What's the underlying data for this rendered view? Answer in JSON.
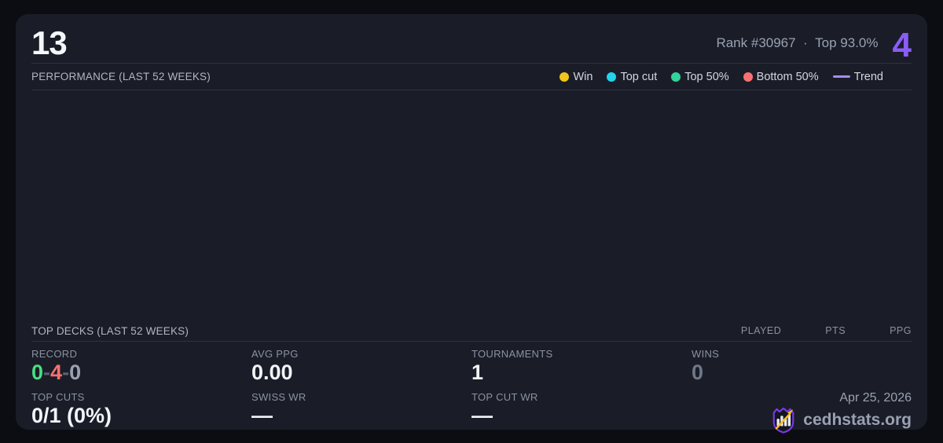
{
  "theme": {
    "page_bg": "#0c0d12",
    "card_bg": "#1a1d28",
    "divider": "#2e3342",
    "accent_purple": "#8b5cf6"
  },
  "header": {
    "title": "13",
    "rank": "Rank #30967",
    "separator": "·",
    "top_percent": "Top 93.0%",
    "color_count": "4",
    "color_count_color": "#8b5cf6"
  },
  "performance": {
    "section_title": "PERFORMANCE (LAST 52 WEEKS)",
    "legend": [
      {
        "label": "Win",
        "color": "#f2c51d",
        "shape": "dot"
      },
      {
        "label": "Top cut",
        "color": "#22d3ee",
        "shape": "dot"
      },
      {
        "label": "Top 50%",
        "color": "#34d399",
        "shape": "dot"
      },
      {
        "label": "Bottom 50%",
        "color": "#f87171",
        "shape": "dot"
      },
      {
        "label": "Trend",
        "color": "#a78bfa",
        "shape": "line"
      }
    ],
    "chart_data": {
      "type": "scatter",
      "points": [],
      "note": "chart area is empty — no events plotted"
    }
  },
  "top_decks": {
    "section_title": "TOP DECKS (LAST 52 WEEKS)",
    "columns": [
      "PLAYED",
      "PTS",
      "PPG"
    ],
    "rows": []
  },
  "stats": {
    "record": {
      "label": "RECORD",
      "parts": [
        {
          "text": "0",
          "color": "#4ade80"
        },
        {
          "text": "-",
          "color": "#5a6170"
        },
        {
          "text": "4",
          "color": "#f87171"
        },
        {
          "text": "-",
          "color": "#5a6170"
        },
        {
          "text": "0",
          "color": "#9aa1b1"
        }
      ]
    },
    "avg_ppg": {
      "label": "AVG PPG",
      "value": "0.00"
    },
    "tournaments": {
      "label": "TOURNAMENTS",
      "value": "1"
    },
    "wins": {
      "label": "WINS",
      "value": "0",
      "value_color": "#6f7787"
    },
    "top_cuts": {
      "label": "TOP CUTS",
      "value": "0/1 (0%)"
    },
    "swiss_wr": {
      "label": "SWISS WR",
      "value": "—"
    },
    "top_cut_wr": {
      "label": "TOP CUT WR",
      "value": "—"
    }
  },
  "footer": {
    "date": "Apr 25, 2026",
    "brand": "cedhstats.org",
    "logo": "cedhstats-shield-logo",
    "logo_colors": {
      "shield": "#7c3aed",
      "bars": "#e8eaf0",
      "arrow": "#fbbf24"
    }
  }
}
